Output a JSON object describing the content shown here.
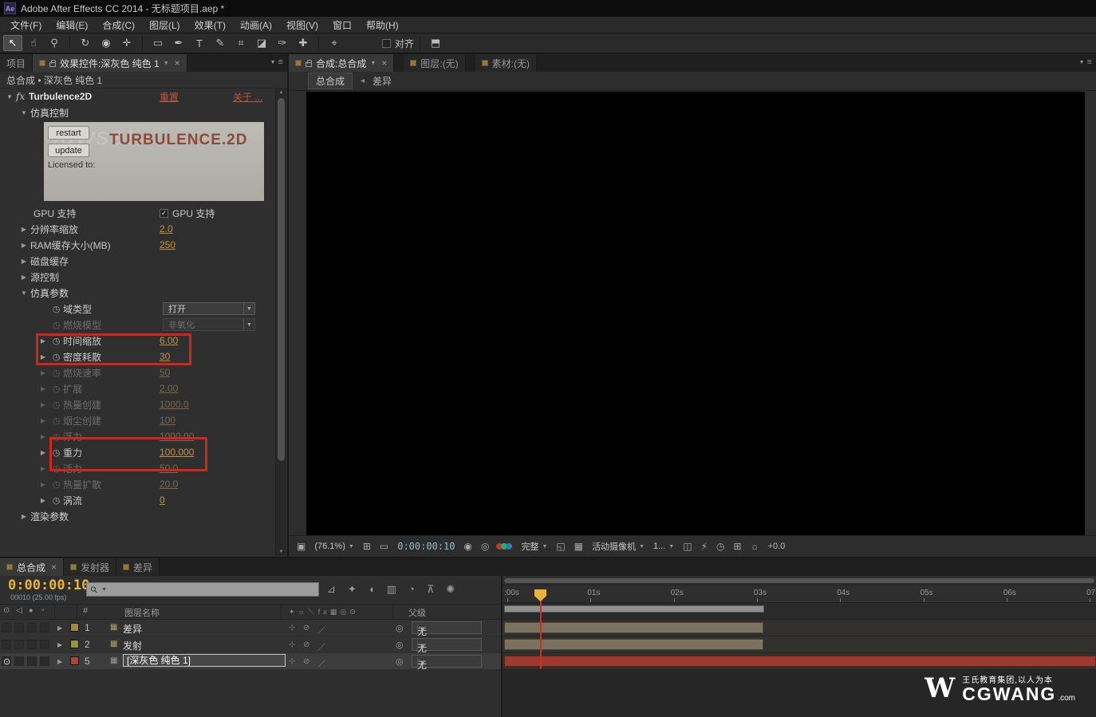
{
  "colors": {
    "value_accent": "#c4923e",
    "link_red": "#bf5742",
    "timecode_yellow": "#e9b33c",
    "annotation": "#d3251b"
  },
  "window": {
    "app_icon": "Ae",
    "title": "Adobe After Effects CC 2014 - 无标题项目.aep *"
  },
  "menu": [
    "文件(F)",
    "编辑(E)",
    "合成(C)",
    "图层(L)",
    "效果(T)",
    "动画(A)",
    "视图(V)",
    "窗口",
    "帮助(H)"
  ],
  "toolbar": {
    "tools": [
      {
        "name": "selection-tool",
        "glyph": "↖",
        "active": true
      },
      {
        "name": "hand-tool",
        "glyph": "☝"
      },
      {
        "name": "zoom-tool",
        "glyph": "⚲"
      },
      {
        "name": "rotation-tool",
        "glyph": "↻"
      },
      {
        "name": "unified-camera-tool",
        "glyph": "◉"
      },
      {
        "name": "pan-behind-tool",
        "glyph": "✛"
      },
      {
        "name": "shape-tool",
        "glyph": "▭"
      },
      {
        "name": "pen-tool",
        "glyph": "✒"
      },
      {
        "name": "type-tool",
        "glyph": "T"
      },
      {
        "name": "brush-tool",
        "glyph": "✎"
      },
      {
        "name": "clone-stamp-tool",
        "glyph": "⌗"
      },
      {
        "name": "eraser-tool",
        "glyph": "◪"
      },
      {
        "name": "roto-brush-tool",
        "glyph": "✑"
      },
      {
        "name": "puppet-pin-tool",
        "glyph": "✚"
      }
    ],
    "align_label": "对齐",
    "align_checked": false,
    "mask_feather_glyph": "⌖",
    "workspace_glyph": "⬒"
  },
  "effects_panel": {
    "project_tab": "项目",
    "effects_tab": "效果控件:深灰色 纯色 1",
    "source_line": "总合成 • 深灰色 纯色 1",
    "effect": {
      "fx_badge": "fx",
      "name": "Turbulence2D",
      "reset": "重置",
      "about": "关于 ..."
    },
    "sim_group_label": "仿真控制",
    "license_box": {
      "restart": "restart",
      "update": "update",
      "licensed_to": "Licensed to:",
      "brand": "TURBULENCE.2D",
      "watermark": "jawset"
    },
    "gpu": {
      "label": "GPU 支持",
      "check_label": "GPU 支持",
      "checked": true
    },
    "rows": [
      {
        "arrow": "right",
        "label": "分辨率缩放",
        "value": "2.0",
        "indent": 0,
        "enabled": true
      },
      {
        "arrow": "right",
        "label": "RAM缓存大小(MB)",
        "value": "250",
        "indent": 0,
        "enabled": true
      },
      {
        "arrow": "right",
        "label": "磁盘缓存",
        "indent": 0,
        "enabled": true
      },
      {
        "arrow": "right",
        "label": "源控制",
        "indent": 0,
        "enabled": true
      },
      {
        "arrow": "down",
        "label": "仿真参数",
        "indent": 0,
        "enabled": true,
        "group": true
      },
      {
        "label": "域类型",
        "stopwatch": true,
        "dropdown": "打开",
        "indent": 1,
        "enabled": true
      },
      {
        "label": "燃烧模型",
        "stopwatch": true,
        "dropdown": "非氧化",
        "indent": 1,
        "enabled": false
      },
      {
        "arrow": "right",
        "label": "时间缩放",
        "stopwatch": true,
        "value": "6.00",
        "indent": 1,
        "enabled": true
      },
      {
        "arrow": "right",
        "label": "密度耗散",
        "stopwatch": true,
        "value": "30",
        "indent": 1,
        "enabled": true
      },
      {
        "arrow": "right",
        "label": "燃烧速率",
        "stopwatch": true,
        "value": "50",
        "indent": 1,
        "enabled": false
      },
      {
        "arrow": "right",
        "label": "扩展",
        "stopwatch": true,
        "value": "2.00",
        "indent": 1,
        "enabled": false
      },
      {
        "arrow": "right",
        "label": "热量创建",
        "stopwatch": true,
        "value": "1000.0",
        "indent": 1,
        "enabled": false
      },
      {
        "arrow": "right",
        "label": "烟尘创建",
        "stopwatch": true,
        "value": "100",
        "indent": 1,
        "enabled": false
      },
      {
        "arrow": "right",
        "label": "浮力",
        "stopwatch": true,
        "value": "1000.00",
        "indent": 1,
        "enabled": false
      },
      {
        "arrow": "right",
        "label": "重力",
        "stopwatch": true,
        "value": "100.000",
        "indent": 1,
        "enabled": true
      },
      {
        "arrow": "right",
        "label": "活力",
        "stopwatch": true,
        "value": "50.0",
        "indent": 1,
        "enabled": false
      },
      {
        "arrow": "right",
        "label": "热量扩散",
        "stopwatch": true,
        "value": "20.0",
        "indent": 1,
        "enabled": false
      },
      {
        "arrow": "right",
        "label": "涡流",
        "stopwatch": true,
        "value": "0",
        "indent": 1,
        "enabled": true
      },
      {
        "arrow": "right",
        "label": "渲染参数",
        "indent": 0,
        "enabled": true,
        "group": true
      }
    ]
  },
  "viewer": {
    "comp_tab": "合成:总合成",
    "layer_tab": "图层:(无)",
    "footage_tab": "素材:(无)",
    "nav": {
      "comp": "总合成",
      "current": "差异"
    },
    "controls": {
      "zoom": "(76.1%)",
      "timecode": "0:00:00:10",
      "resolution": "完整",
      "camera": "活动摄像机",
      "views": "1...",
      "exposure": "+0.0"
    }
  },
  "timeline": {
    "tabs": [
      {
        "label": "总合成"
      },
      {
        "label": "发射器"
      },
      {
        "label": "差异"
      }
    ],
    "timecode": "0:00:00:10",
    "frame_info": "00010 (25.00 fps)",
    "header": {
      "index": "#",
      "name": "图层名称",
      "parent": "父级"
    },
    "ruler": [
      ":00s",
      "01s",
      "02s",
      "03s",
      "04s",
      "05s",
      "06s",
      "07"
    ],
    "layers": [
      {
        "index": "1",
        "name": "差异",
        "chip": "#a8873b",
        "type": "comp",
        "parent": "无",
        "bar_end": 3.12,
        "bar_color": "#7b7260",
        "eye": false,
        "selected": false
      },
      {
        "index": "2",
        "name": "发射",
        "chip": "#97923c",
        "type": "comp",
        "parent": "无",
        "bar_end": 3.12,
        "bar_color": "#7b7260",
        "eye": false,
        "selected": false
      },
      {
        "index": "5",
        "name": "[深灰色 纯色 1]",
        "chip": "#b04038",
        "type": "solid",
        "parent": "无",
        "bar_end": 7.15,
        "bar_color": "#9d392f",
        "eye": true,
        "selected": true
      }
    ]
  },
  "tl_icons": [
    {
      "name": "comp-mini-flowchart-icon",
      "glyph": "⊿"
    },
    {
      "name": "draft-3d-icon",
      "glyph": "✦"
    },
    {
      "name": "hide-shy-icon",
      "glyph": "◖"
    },
    {
      "name": "frame-blend-icon",
      "glyph": "▥"
    },
    {
      "name": "motion-blur-icon",
      "glyph": "◔"
    },
    {
      "name": "graph-editor-icon",
      "glyph": "⊼"
    },
    {
      "name": "brainstorm-icon",
      "glyph": "✺"
    }
  ],
  "watermark": {
    "logo": "W",
    "tagline": "王氏教育集团,以人为本",
    "brand": "CGWANG",
    "domain": ".com"
  },
  "icons": {
    "twirl_down": "▼",
    "twirl_right": "▶",
    "close": "×",
    "chevron_down": "▼",
    "stopwatch": "◷",
    "panel_menu": "≡",
    "search": "⚲",
    "check": "✓",
    "eye": "⊙",
    "audio": "◁",
    "solo": "●",
    "lock": "▫",
    "pickwhip": "◎",
    "snapshot": "◉",
    "show_snapshot": "◎",
    "grid": "⊞",
    "mask": "▭",
    "roi": "◱",
    "transparency": "▦",
    "sun": "☼",
    "fit": "▣",
    "pixel_aspect": "◫",
    "fast_preview": "⚡",
    "clock": "◷",
    "nav_arrow": "◂",
    "bullet": "⊹",
    "slash": "／",
    "circle_slash": "⊘"
  }
}
